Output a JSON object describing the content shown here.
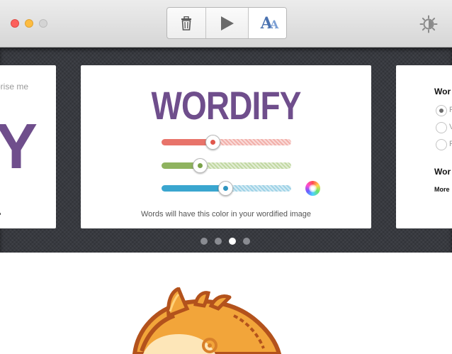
{
  "toolbar": {
    "delete_icon": "trash-icon",
    "play_icon": "play-icon",
    "font_button_label": "A",
    "font_button_label_small": "A",
    "settings_icon": "brightness-icon"
  },
  "carousel": {
    "left_card": {
      "text": "rprise me",
      "big_letter": "Y"
    },
    "center_card": {
      "title": "WORDIFY",
      "caption": "Words will have this color in your wordified image",
      "sliders": [
        {
          "color": "#e8736a",
          "level": 0.4
        },
        {
          "color": "#8fb35f",
          "level": 0.3
        },
        {
          "color": "#3aa6cf",
          "level": 0.5
        }
      ]
    },
    "right_card": {
      "title1": "Wor",
      "radio_labels": [
        "F",
        "V",
        "F"
      ],
      "title2": "Wor",
      "more": "More"
    },
    "pages": 4,
    "active_page": 3
  },
  "colors": {
    "brand_purple": "#6f4e8c"
  }
}
